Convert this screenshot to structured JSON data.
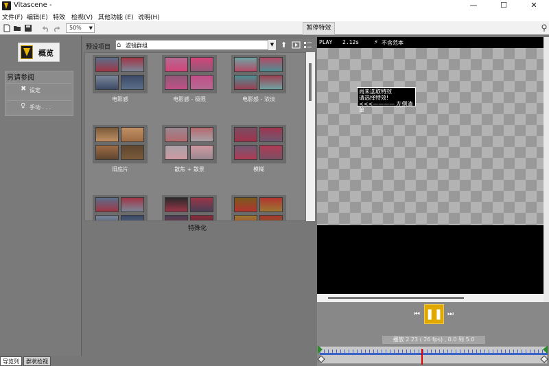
{
  "window": {
    "title": "Vitascene -",
    "minimize": "—",
    "maximize": "☐",
    "close": "✕"
  },
  "menu": [
    "文件(F)",
    "编辑(E)",
    "特效",
    "检视(V)",
    "其他功能 (E)",
    "说明(H)"
  ],
  "toolbar": {
    "zoom": "50%",
    "pause_effect_tab": "暂停特效",
    "tools": [
      "new-file-icon",
      "open-folder-icon",
      "save-icon",
      "undo-icon",
      "redo-icon"
    ]
  },
  "left_panel": {
    "overview_label": "概览",
    "wizard_title": "另请参阅",
    "wizard_items": [
      {
        "icon": "✖",
        "label": "设定"
      },
      {
        "icon": "♀",
        "label": "手动 . . ."
      }
    ]
  },
  "presets": {
    "label": "预设项目",
    "folder": "滤镜群组",
    "category": "特殊化",
    "items": [
      {
        "name": "电影感",
        "tint": "cool"
      },
      {
        "name": "电影感 - 极限",
        "tint": "pink"
      },
      {
        "name": "电影感 - 浓淡",
        "tint": "teal"
      },
      {
        "name": "旧底片",
        "tint": "warm"
      },
      {
        "name": "散焦 + 散景",
        "tint": "blur"
      },
      {
        "name": "模糊",
        "tint": "red"
      },
      {
        "name": "",
        "tint": "cool"
      },
      {
        "name": "",
        "tint": "dark"
      },
      {
        "name": "",
        "tint": "gold"
      }
    ]
  },
  "preview": {
    "play_label": "PLAY",
    "time": "2.12s",
    "lightning_icon": "⚡",
    "mode": "不含范本",
    "no_effect_lines": [
      "尚未选取特效",
      "请选择特效!",
      "<<<———— 左侧清单"
    ]
  },
  "transport": {
    "prev": "⏮",
    "pause": "❚❚",
    "next": "⏭",
    "playback_info": "播放 2.23 ( 26 fps) , 0.0 到 5.0",
    "cursor_fraction": 0.446
  },
  "bottom_tabs": {
    "navigator": "导览列",
    "tree": "群状检视"
  },
  "colors": {
    "accent": "#e1a900",
    "timeline": "#3a63c5",
    "cursor": "#e00000"
  }
}
